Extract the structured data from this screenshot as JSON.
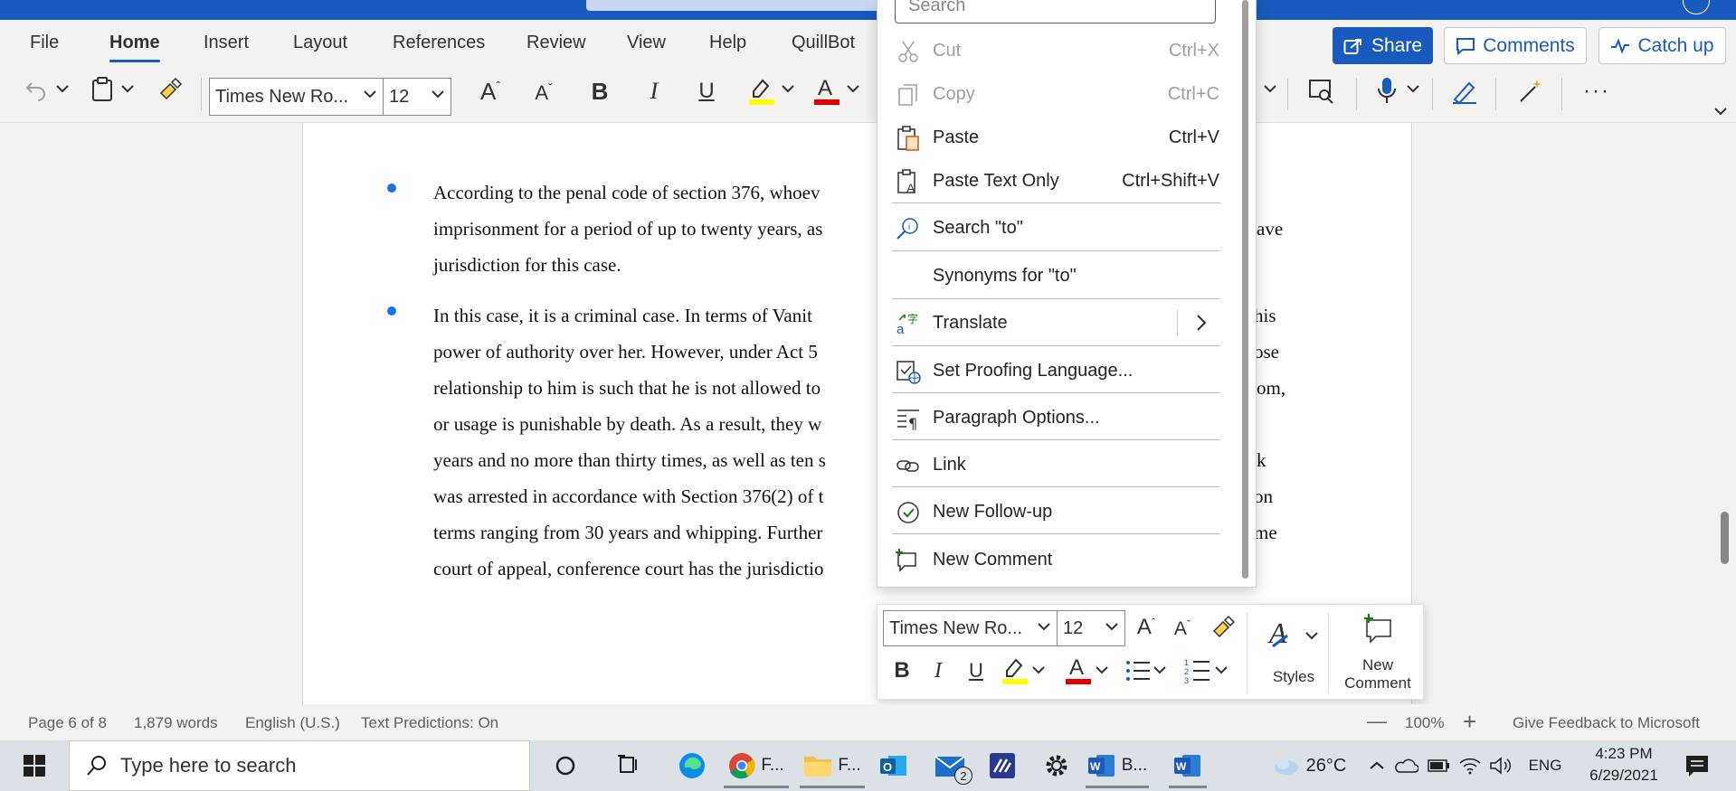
{
  "menu": {
    "tabs": [
      "File",
      "Home",
      "Insert",
      "Layout",
      "References",
      "Review",
      "View",
      "Help",
      "QuillBot"
    ],
    "active": "Home",
    "share_label": "Share",
    "comments_label": "Comments",
    "catchup_label": "Catch up"
  },
  "ribbon": {
    "font_name": "Times New Ro...",
    "font_size": "12"
  },
  "document": {
    "bullet1_lines": [
      "According to the penal code of section 376, whoev",
      "imprisonment for a period of up to twenty years, as",
      "jurisdiction for this case."
    ],
    "bullet1_right": [
      "",
      "ave",
      ""
    ],
    "bullet2_lines": [
      " In this case, it is a criminal case. In terms of Vanit",
      "power of authority over her. However, under Act 5",
      "relationship to him is such that he is not allowed to",
      "or usage is punishable by death. As a result, they w",
      "years and no more than thirty times, as well as ten s",
      "was arrested in accordance with Section 376(2) of t",
      "terms ranging from 30 years and whipping. Further",
      "court of appeal, conference court has the jurisdictio"
    ],
    "bullet2_right": [
      "his",
      "ose",
      "om,",
      "",
      "k",
      "on",
      "me",
      ""
    ]
  },
  "context_menu": {
    "search_placeholder": "Search",
    "items": [
      {
        "label": "Cut",
        "shortcut": "Ctrl+X",
        "icon": "scissors-icon",
        "disabled": true
      },
      {
        "label": "Copy",
        "shortcut": "Ctrl+C",
        "icon": "copy-icon",
        "disabled": true
      },
      {
        "label": "Paste",
        "shortcut": "Ctrl+V",
        "icon": "paste-icon",
        "disabled": false
      },
      {
        "label": "Paste Text Only",
        "shortcut": "Ctrl+Shift+V",
        "icon": "paste-text-icon",
        "disabled": false
      },
      {
        "label": "Search \"to\"",
        "shortcut": "",
        "icon": "search-icon",
        "disabled": false
      },
      {
        "label": "Synonyms for \"to\"",
        "shortcut": "",
        "icon": "",
        "disabled": false
      },
      {
        "label": "Translate",
        "shortcut": "",
        "icon": "translate-icon",
        "disabled": false
      },
      {
        "label": "Set Proofing Language...",
        "shortcut": "",
        "icon": "proofing-language-icon",
        "disabled": false
      },
      {
        "label": "Paragraph Options...",
        "shortcut": "",
        "icon": "paragraph-icon",
        "disabled": false
      },
      {
        "label": "Link",
        "shortcut": "",
        "icon": "link-icon",
        "disabled": false
      },
      {
        "label": "New Follow-up",
        "shortcut": "",
        "icon": "follow-up-icon",
        "disabled": false
      },
      {
        "label": "New Comment",
        "shortcut": "",
        "icon": "new-comment-icon",
        "disabled": false
      }
    ]
  },
  "mini_toolbar": {
    "font_name": "Times New Ro...",
    "font_size": "12",
    "styles_label": "Styles",
    "new_comment_line1": "New",
    "new_comment_line2": "Comment"
  },
  "status": {
    "page": "Page 6 of 8",
    "words": "1,879 words",
    "language": "English (U.S.)",
    "predictions": "Text Predictions: On",
    "zoom": "100%",
    "feedback": "Give Feedback to Microsoft"
  },
  "taskbar": {
    "search_placeholder": "Type here to search",
    "chrome_label": "F...",
    "explorer_label": "F...",
    "mail_badge": "2",
    "word_label": "B...",
    "temperature": "26°C",
    "lang": "ENG",
    "time": "4:23 PM",
    "date": "6/29/2021"
  },
  "colors": {
    "accent": "#185abd",
    "bullet": "#1a73e8",
    "highlight": "#ffff00",
    "font_color": "#e00000"
  }
}
